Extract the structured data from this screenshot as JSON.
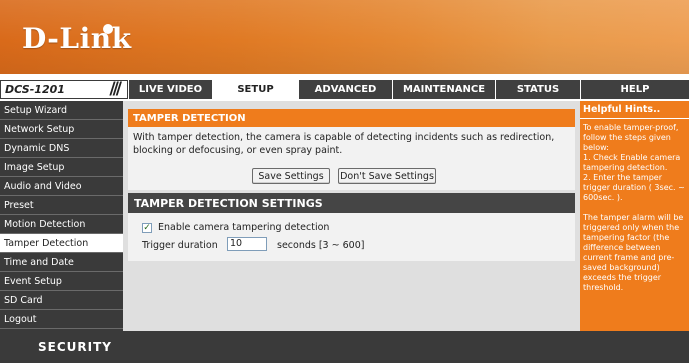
{
  "header": {
    "logo_text": "D-Link",
    "model": "DCS-1201",
    "model_slashes": "///"
  },
  "nav": {
    "tabs": [
      {
        "label": "LIVE VIDEO"
      },
      {
        "label": "SETUP"
      },
      {
        "label": "ADVANCED"
      },
      {
        "label": "MAINTENANCE"
      },
      {
        "label": "STATUS"
      },
      {
        "label": "HELP"
      }
    ],
    "active": "SETUP"
  },
  "sidebar": {
    "items": [
      {
        "label": "Setup Wizard"
      },
      {
        "label": "Network Setup"
      },
      {
        "label": "Dynamic DNS"
      },
      {
        "label": "Image Setup"
      },
      {
        "label": "Audio and Video"
      },
      {
        "label": "Preset"
      },
      {
        "label": "Motion Detection"
      },
      {
        "label": "Tamper Detection"
      },
      {
        "label": "Time and Date"
      },
      {
        "label": "Event Setup"
      },
      {
        "label": "SD Card"
      },
      {
        "label": "Logout"
      }
    ],
    "active": "Tamper Detection"
  },
  "tamper": {
    "title": "TAMPER DETECTION",
    "description": "With tamper detection, the camera is capable of detecting incidents such as redirection, blocking or defocusing, or even spray paint.",
    "save_label": "Save Settings",
    "dont_save_label": "Don't Save Settings"
  },
  "settings": {
    "title": "TAMPER DETECTION SETTINGS",
    "enable_label": "Enable camera tampering detection",
    "enable_checked": true,
    "duration_label": "Trigger duration",
    "duration_value": "10",
    "duration_unit": "seconds [3 ~ 600]"
  },
  "hints": {
    "title": "Helpful Hints..",
    "body": "To enable tamper-proof,\nfollow the steps given\nbelow:\n1. Check Enable camera\ntampering detection.\n2. Enter the tamper\ntrigger duration ( 3sec. ~\n600sec. ).\n\nThe tamper alarm will be\ntriggered only when the\ntampering factor (the\ndifference between\ncurrent frame and pre-\nsaved background)\nexceeds the trigger\nthreshold."
  },
  "footer": {
    "label": "SECURITY"
  },
  "colors": {
    "accent": "#ef7c1c",
    "dark": "#3a3a3a",
    "panel": "#dfdfdf"
  }
}
